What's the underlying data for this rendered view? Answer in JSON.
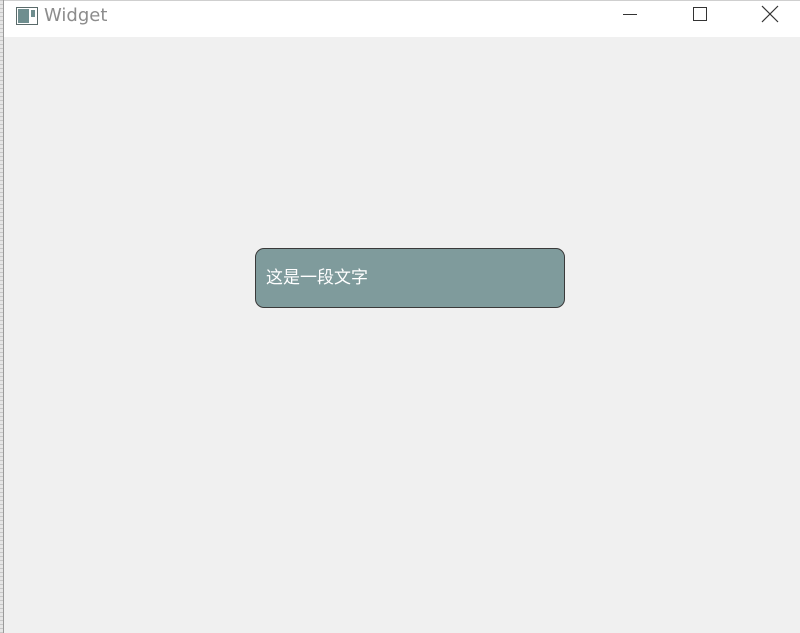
{
  "window": {
    "title": "Widget"
  },
  "label": {
    "text": "这是一段文字"
  },
  "icons": {
    "app": "app-window-icon",
    "minimize": "minimize-icon",
    "maximize": "maximize-icon",
    "close": "close-icon"
  },
  "colors": {
    "label_background": "#7f9b9c",
    "window_background": "#f0f0f0",
    "titlebar_background": "#ffffff"
  }
}
